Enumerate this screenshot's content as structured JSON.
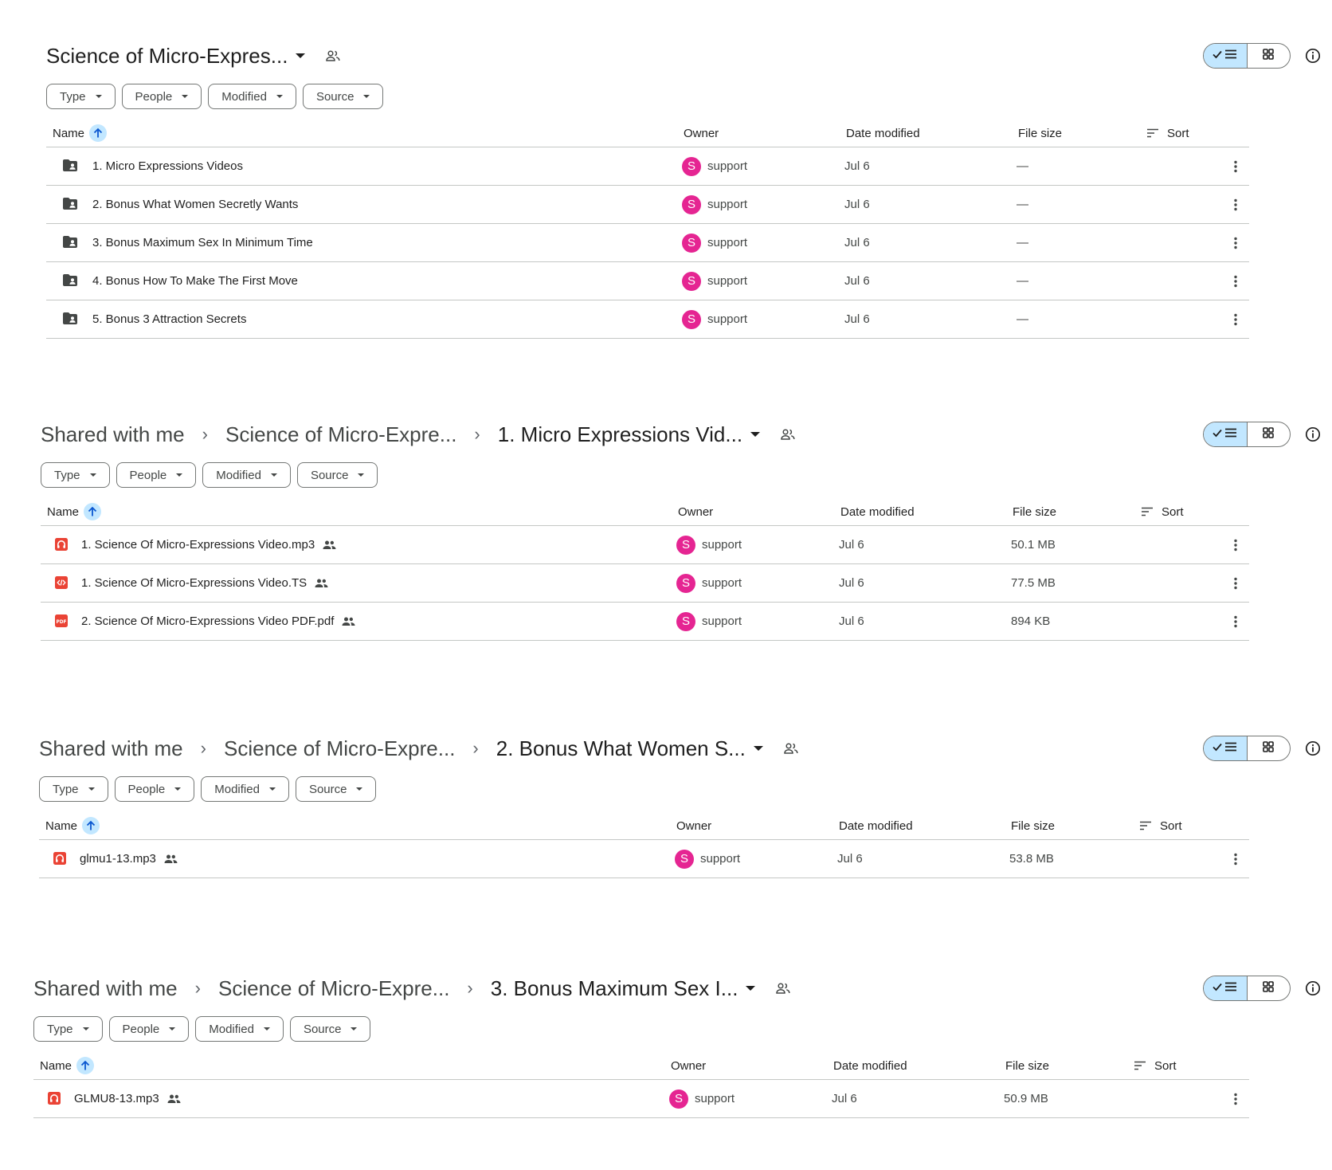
{
  "colors": {
    "accent": "#c2e7ff",
    "avatar": "#e52592",
    "audio_red": "#ea4335",
    "folder": "#444746"
  },
  "filters": [
    "Type",
    "People",
    "Modified",
    "Source"
  ],
  "columns": {
    "name": "Name",
    "owner": "Owner",
    "date": "Date modified",
    "size": "File size",
    "sort": "Sort"
  },
  "panels": [
    {
      "breadcrumb": [
        "Science of Micro-Expres..."
      ],
      "rows": [
        {
          "icon": "shared-folder-icon",
          "name": "1. Micro Expressions Videos",
          "owner": "support",
          "avatar": "S",
          "date": "Jul 6",
          "size": "—",
          "shared": false
        },
        {
          "icon": "shared-folder-icon",
          "name": "2. Bonus What Women Secretly Wants",
          "owner": "support",
          "avatar": "S",
          "date": "Jul 6",
          "size": "—",
          "shared": false
        },
        {
          "icon": "shared-folder-icon",
          "name": "3. Bonus Maximum Sex In Minimum Time",
          "owner": "support",
          "avatar": "S",
          "date": "Jul 6",
          "size": "—",
          "shared": false
        },
        {
          "icon": "shared-folder-icon",
          "name": "4. Bonus How To Make The First Move",
          "owner": "support",
          "avatar": "S",
          "date": "Jul 6",
          "size": "—",
          "shared": false
        },
        {
          "icon": "shared-folder-icon",
          "name": "5. Bonus 3 Attraction Secrets",
          "owner": "support",
          "avatar": "S",
          "date": "Jul 6",
          "size": "—",
          "shared": false
        }
      ]
    },
    {
      "breadcrumb": [
        "Shared with me",
        "Science of Micro-Expre...",
        "1. Micro Expressions Vid..."
      ],
      "rows": [
        {
          "icon": "audio-file-icon",
          "name": "1. Science Of Micro-Expressions Video.mp3",
          "owner": "support",
          "avatar": "S",
          "date": "Jul 6",
          "size": "50.1 MB",
          "shared": true
        },
        {
          "icon": "code-file-icon",
          "name": "1. Science Of Micro-Expressions Video.TS",
          "owner": "support",
          "avatar": "S",
          "date": "Jul 6",
          "size": "77.5 MB",
          "shared": true
        },
        {
          "icon": "pdf-file-icon",
          "name": "2. Science Of Micro-Expressions Video PDF.pdf",
          "owner": "support",
          "avatar": "S",
          "date": "Jul 6",
          "size": "894 KB",
          "shared": true
        }
      ]
    },
    {
      "breadcrumb": [
        "Shared with me",
        "Science of Micro-Expre...",
        "2. Bonus What Women S..."
      ],
      "rows": [
        {
          "icon": "audio-file-icon",
          "name": "glmu1-13.mp3",
          "owner": "support",
          "avatar": "S",
          "date": "Jul 6",
          "size": "53.8 MB",
          "shared": true
        }
      ]
    },
    {
      "breadcrumb": [
        "Shared with me",
        "Science of Micro-Expre...",
        "3. Bonus Maximum Sex I..."
      ],
      "rows": [
        {
          "icon": "audio-file-icon",
          "name": "GLMU8-13.mp3",
          "owner": "support",
          "avatar": "S",
          "date": "Jul 6",
          "size": "50.9 MB",
          "shared": true
        }
      ]
    }
  ]
}
